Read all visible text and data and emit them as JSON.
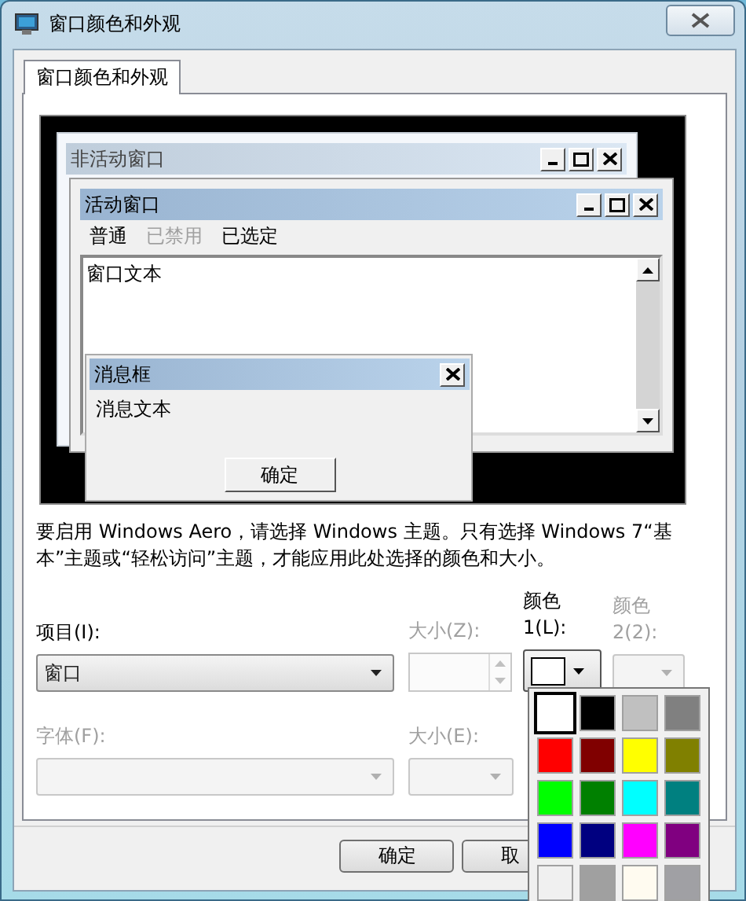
{
  "window": {
    "title": "窗口颜色和外观"
  },
  "tabs": [
    {
      "label": "窗口颜色和外观",
      "selected": true
    }
  ],
  "preview": {
    "inactive_window": {
      "title": "非活动窗口"
    },
    "active_window": {
      "title": "活动窗口",
      "menu": [
        {
          "label": "普通",
          "disabled": false
        },
        {
          "label": "已禁用",
          "disabled": true
        },
        {
          "label": "已选定",
          "disabled": false
        }
      ],
      "text": "窗口文本"
    },
    "message_box": {
      "title": "消息框",
      "text": "消息文本",
      "button": "确定"
    }
  },
  "description": "要启用 Windows Aero，请选择 Windows 主题。只有选择 Windows 7“基本”主题或“轻松访问”主题，才能应用此处选择的颜色和大小。",
  "item": {
    "label": "项目(I):",
    "value": "窗口"
  },
  "item_size": {
    "label": "大小(Z):",
    "disabled": true
  },
  "color_1": {
    "label_lines": [
      "颜色",
      "1(L):"
    ],
    "disabled": false
  },
  "color_2": {
    "label_lines": [
      "颜色",
      "2(2):"
    ],
    "disabled": true
  },
  "font": {
    "label": "字体(F):",
    "disabled": true
  },
  "font_size": {
    "label": "大小(E):",
    "disabled": true
  },
  "buttons": [
    "确定",
    "取"
  ],
  "color_palette": [
    {
      "color": "#ffffff",
      "selected": true
    },
    {
      "color": "#000000",
      "selected": false
    },
    {
      "color": "#c0c0c0",
      "selected": false
    },
    {
      "color": "#808080",
      "selected": false
    },
    {
      "color": "#ff0000",
      "selected": false
    },
    {
      "color": "#800000",
      "selected": false
    },
    {
      "color": "#ffff00",
      "selected": false
    },
    {
      "color": "#808000",
      "selected": false
    },
    {
      "color": "#00ff00",
      "selected": false
    },
    {
      "color": "#008000",
      "selected": false
    },
    {
      "color": "#00ffff",
      "selected": false
    },
    {
      "color": "#008080",
      "selected": false
    },
    {
      "color": "#0000ff",
      "selected": false
    },
    {
      "color": "#000080",
      "selected": false
    },
    {
      "color": "#ff00ff",
      "selected": false
    },
    {
      "color": "#800080",
      "selected": false
    },
    {
      "color": "#f0f0f0",
      "selected": false
    },
    {
      "color": "#a0a0a0",
      "selected": false
    },
    {
      "color": "#fffbf0",
      "selected": false
    },
    {
      "color": "#a0a0a4",
      "selected": false
    }
  ]
}
